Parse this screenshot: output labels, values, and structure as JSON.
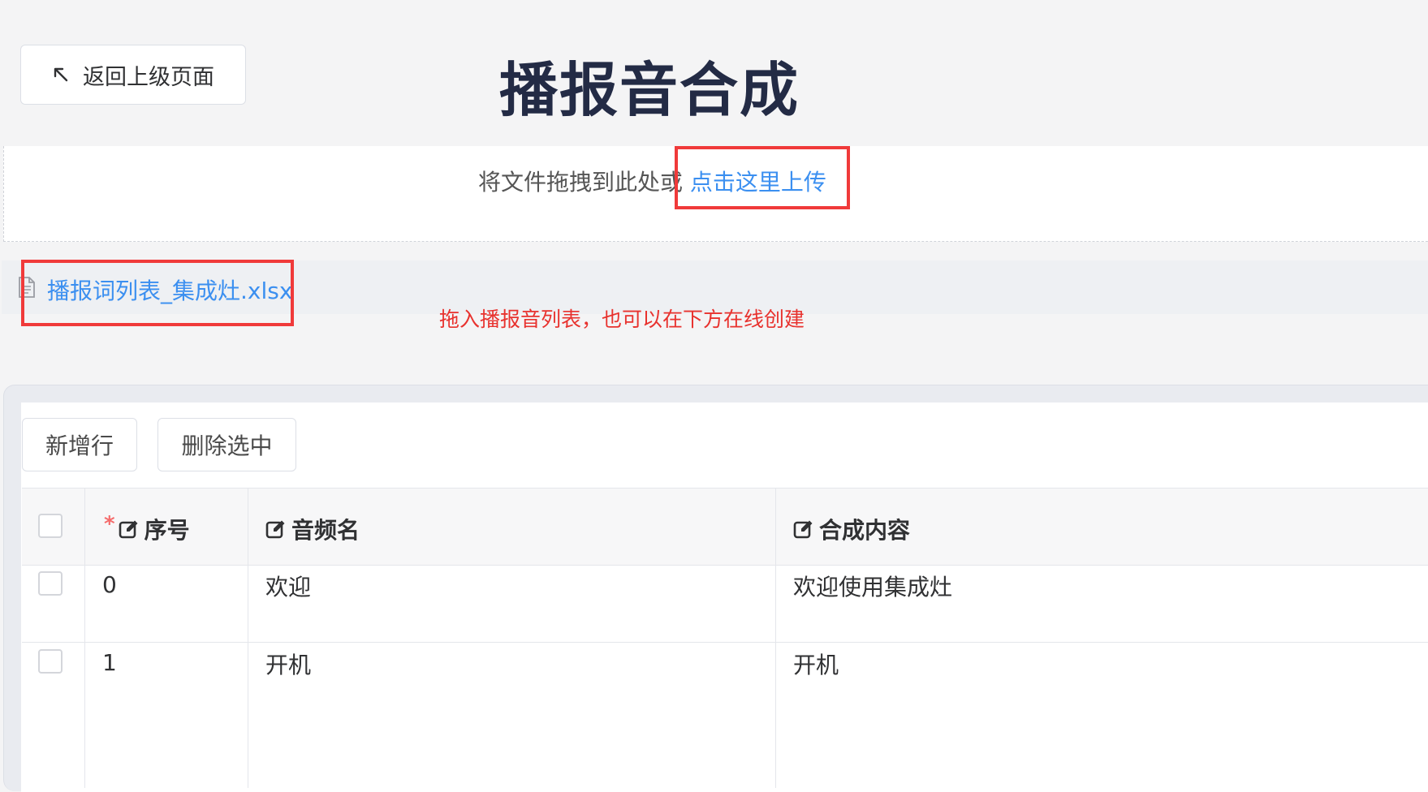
{
  "header": {
    "back_label": "返回上级页面",
    "title": "播报音合成"
  },
  "upload": {
    "hint": "将文件拖拽到此处或",
    "link": "点击这里上传"
  },
  "file_list": [
    {
      "name": "播报词列表_集成灶.xlsx"
    }
  ],
  "annotation": "拖入播报音列表，也可以在下方在线创建",
  "toolbar": {
    "add_label": "新增行",
    "delete_label": "删除选中"
  },
  "table": {
    "required_mark": "*",
    "columns": [
      "序号",
      "音频名",
      "合成内容"
    ],
    "rows": [
      {
        "index": "0",
        "audio_name": "欢迎",
        "content": "欢迎使用集成灶"
      },
      {
        "index": "1",
        "audio_name": "开机",
        "content": "开机"
      }
    ]
  },
  "colors": {
    "accent": "#3b8ff0",
    "highlight": "#f03a3a",
    "annotation": "#e8322e",
    "title": "#232b45"
  }
}
